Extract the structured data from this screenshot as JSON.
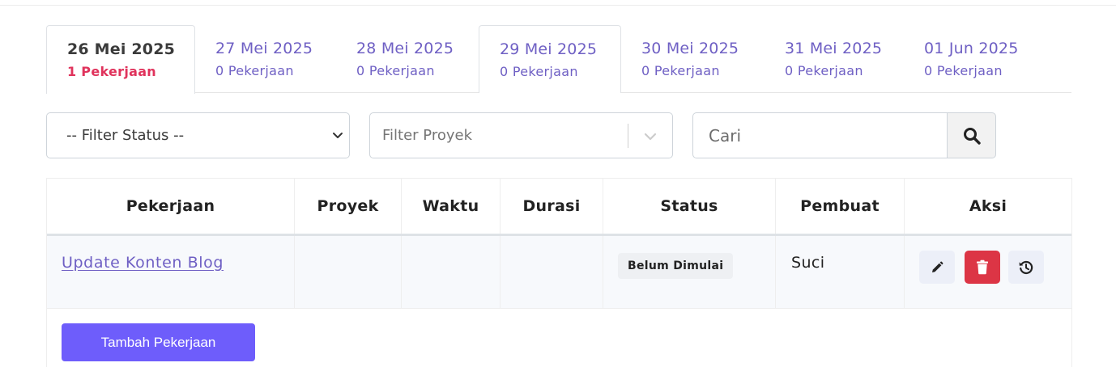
{
  "tabs": [
    {
      "date": "26 Mei 2025",
      "count": "1 Pekerjaan",
      "active": true
    },
    {
      "date": "27 Mei 2025",
      "count": "0 Pekerjaan"
    },
    {
      "date": "28 Mei 2025",
      "count": "0 Pekerjaan"
    },
    {
      "date": "29 Mei 2025",
      "count": "0 Pekerjaan"
    },
    {
      "date": "30 Mei 2025",
      "count": "0 Pekerjaan"
    },
    {
      "date": "31 Mei 2025",
      "count": "0 Pekerjaan"
    },
    {
      "date": "01 Jun 2025",
      "count": "0 Pekerjaan"
    }
  ],
  "filters": {
    "status_selected": "-- Filter Status --",
    "proyek_placeholder": "Filter Proyek",
    "search_placeholder": "Cari",
    "search_icon": "search-icon"
  },
  "table": {
    "headers": [
      "Pekerjaan",
      "Proyek",
      "Waktu",
      "Durasi",
      "Status",
      "Pembuat",
      "Aksi"
    ],
    "rows": [
      {
        "pekerjaan": "Update Konten Blog",
        "proyek": "",
        "waktu": "",
        "durasi": "",
        "status": "Belum Dimulai",
        "pembuat": "Suci",
        "actions": [
          "pencil-icon",
          "trash-icon",
          "history-icon"
        ]
      }
    ]
  },
  "add_button_label": "Tambah Pekerjaan",
  "colors": {
    "accent": "#6f60c4",
    "active_count": "#e0335c",
    "primary_button": "#6e5dfb",
    "danger": "#dc3545"
  }
}
